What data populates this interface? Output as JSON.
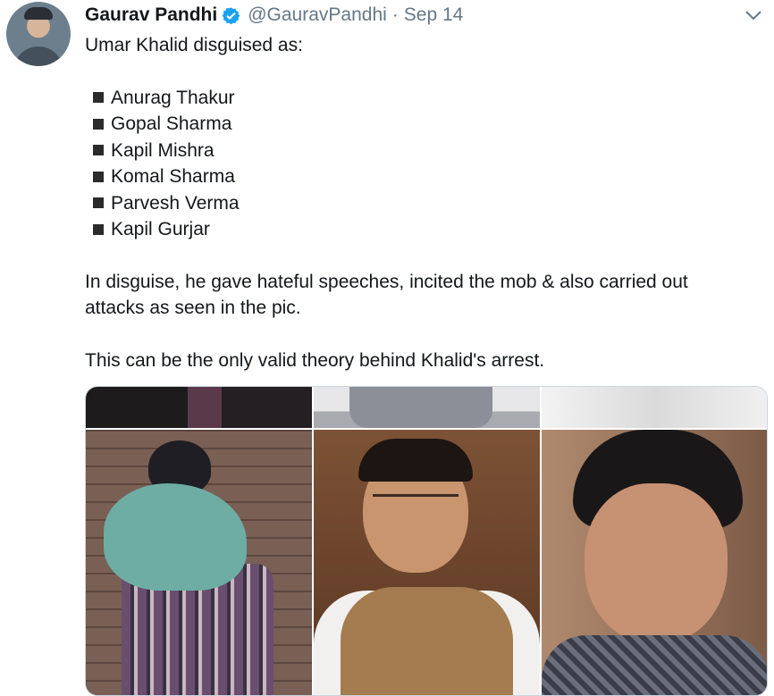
{
  "tweet": {
    "author_name": "Gaurav Pandhi",
    "handle": "@GauravPandhi",
    "separator": "·",
    "date": "Sep 14",
    "intro": "Umar Khalid disguised as:",
    "list": [
      "Anurag Thakur",
      "Gopal Sharma",
      "Kapil Mishra",
      "Komal Sharma",
      "Parvesh Verma",
      "Kapil Gurjar"
    ],
    "para1": "In disguise, he gave hateful speeches, incited the mob & also carried out attacks as seen in the pic.",
    "para2": "This can be the only valid theory behind Khalid's arrest."
  },
  "icons": {
    "verified": "verified-badge-icon",
    "menu": "chevron-down-icon"
  },
  "colors": {
    "verified_blue": "#1da1f2",
    "secondary_text": "#657786",
    "primary_text": "#14171a"
  }
}
